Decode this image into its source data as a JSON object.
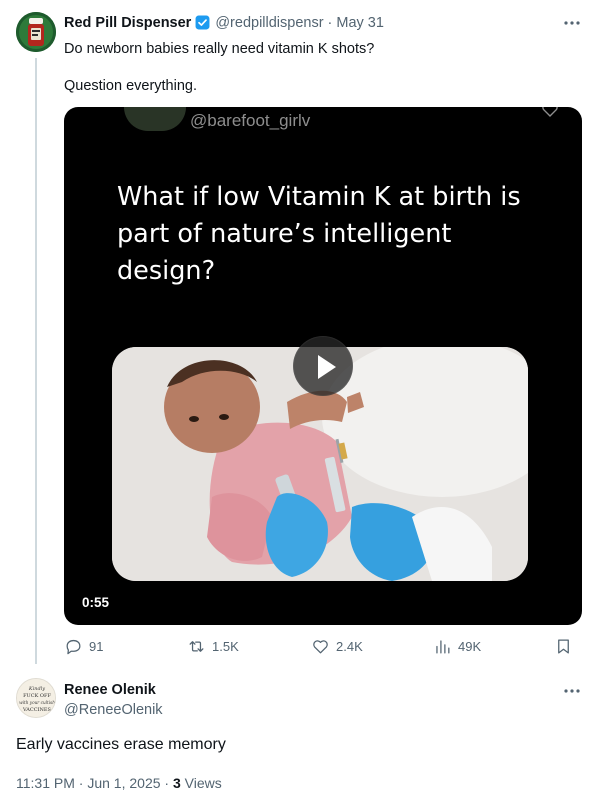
{
  "tweet1": {
    "author_name": "Red Pill Dispenser",
    "handle": "@redpilldispensr",
    "separator": "·",
    "date": "May 31",
    "line1": "Do newborn babies really need vitamin K shots?",
    "line2": "Question everything.",
    "avatar_icon": "pill-bottle-avatar",
    "verified_icon": "verified-badge-icon",
    "more_icon": "more-dots-icon",
    "media": {
      "watermark": "@barefoot_girlv",
      "caption": "What if low Vitamin K at birth is part of nature’s intelligent design?",
      "duration": "0:55",
      "play_icon": "play-icon"
    },
    "actions": {
      "replies": "91",
      "reposts": "1.5K",
      "likes": "2.4K",
      "views": "49K"
    }
  },
  "tweet2": {
    "author_name": "Renee Olenik",
    "handle": "@ReneeOlenik",
    "text": "Early vaccines erase memory",
    "time": "11:31 PM",
    "separator": "·",
    "date": "Jun 1, 2025",
    "views_count": "3",
    "views_label": "Views",
    "avatar_text": "Kindly FUCK OFF with your cultish VACCINES"
  },
  "colors": {
    "text": "#0f1419",
    "muted": "#536471",
    "verified": "#1d9bf0",
    "thread_line": "#cfd9de"
  }
}
